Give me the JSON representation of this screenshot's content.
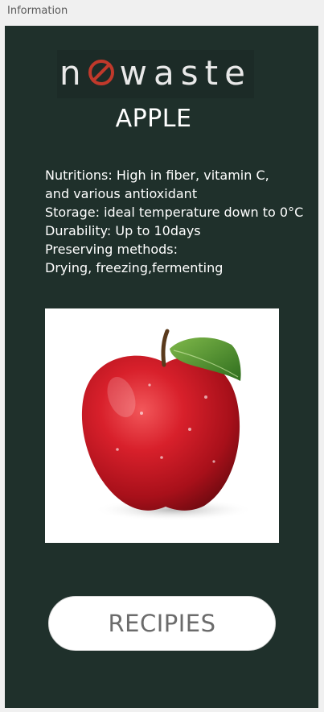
{
  "window": {
    "title": "Information"
  },
  "logo": {
    "prefix": "n",
    "suffix": "waste",
    "accent_color": "#c0392b"
  },
  "product": {
    "name": "APPLE",
    "info_lines": [
      "Nutritions:  High in fiber, vitamin C,",
      "and various antioxidant",
      "Storage: ideal temperature down to 0°C",
      "Durability: Up to 10days",
      "Preserving methods:",
      "Drying, freezing,fermenting"
    ],
    "image_icon": "apple-photo"
  },
  "actions": {
    "recipes_label": "RECIPIES"
  },
  "colors": {
    "panel_background": "#1f302b",
    "text": "#ffffff",
    "button_background": "#ffffff",
    "button_text": "#6b6b6b"
  }
}
